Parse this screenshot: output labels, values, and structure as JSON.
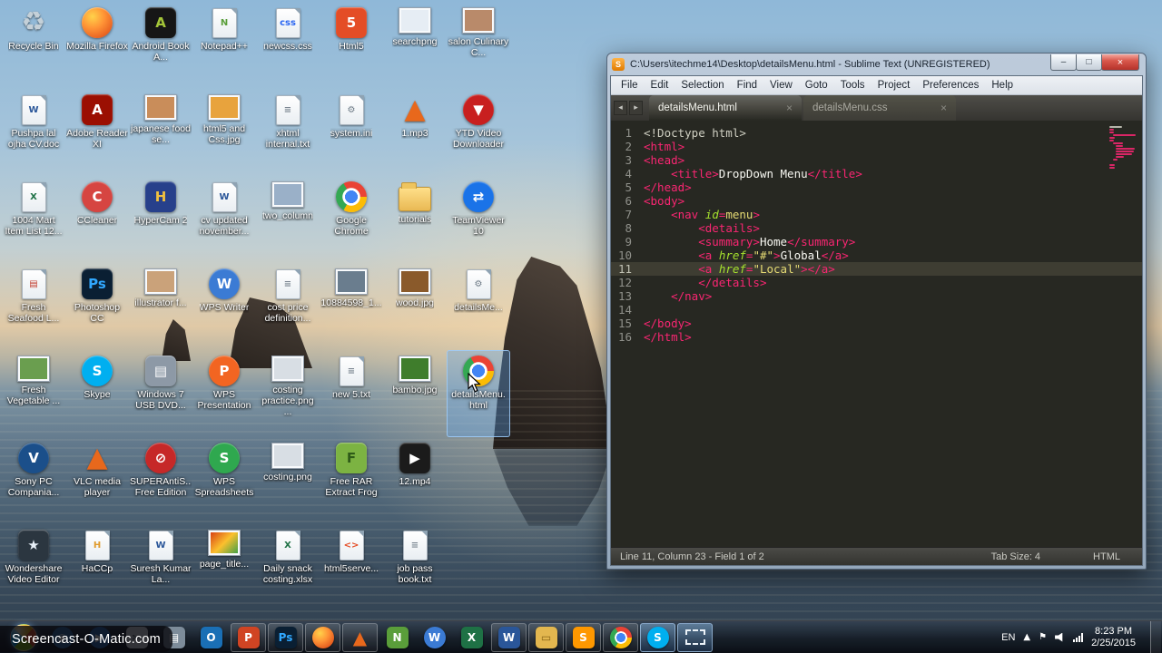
{
  "watermark": "Screencast-O-Matic.com",
  "window": {
    "title": "C:\\Users\\itechme14\\Desktop\\detailsMenu.html - Sublime Text (UNREGISTERED)",
    "app_icon_letter": "S",
    "controls": {
      "minimize": "–",
      "maximize": "□",
      "close": "×"
    },
    "menu": [
      "File",
      "Edit",
      "Selection",
      "Find",
      "View",
      "Goto",
      "Tools",
      "Project",
      "Preferences",
      "Help"
    ],
    "tab_arrows": {
      "left": "◂",
      "right": "▸"
    },
    "tabs": [
      {
        "label": "detailsMenu.html",
        "active": true
      },
      {
        "label": "detailsMenu.css",
        "active": false
      }
    ],
    "code": {
      "current_line": 11,
      "lines": [
        {
          "n": 1,
          "t": [
            [
              "plain",
              "<!Doctype html>"
            ]
          ]
        },
        {
          "n": 2,
          "t": [
            [
              "tag",
              "<html>"
            ]
          ]
        },
        {
          "n": 3,
          "t": [
            [
              "tag",
              "<head>"
            ]
          ]
        },
        {
          "n": 4,
          "t": [
            [
              "sp",
              "    "
            ],
            [
              "tag",
              "<title>"
            ],
            [
              "text",
              "DropDown Menu"
            ],
            [
              "tag",
              "</title>"
            ]
          ]
        },
        {
          "n": 5,
          "t": [
            [
              "tag",
              "</head>"
            ]
          ]
        },
        {
          "n": 6,
          "t": [
            [
              "tag",
              "<body>"
            ]
          ]
        },
        {
          "n": 7,
          "t": [
            [
              "sp",
              "    "
            ],
            [
              "tag",
              "<nav"
            ],
            [
              "sp",
              " "
            ],
            [
              "attr",
              "id"
            ],
            [
              "op",
              "="
            ],
            [
              "val",
              "menu"
            ],
            [
              "tag",
              ">"
            ]
          ]
        },
        {
          "n": 8,
          "t": [
            [
              "sp",
              "        "
            ],
            [
              "tag",
              "<details>"
            ]
          ]
        },
        {
          "n": 9,
          "t": [
            [
              "sp",
              "        "
            ],
            [
              "tag",
              "<summary>"
            ],
            [
              "text",
              "Home"
            ],
            [
              "tag",
              "</summary>"
            ]
          ]
        },
        {
          "n": 10,
          "t": [
            [
              "sp",
              "        "
            ],
            [
              "tag",
              "<a"
            ],
            [
              "sp",
              " "
            ],
            [
              "attr",
              "href"
            ],
            [
              "op",
              "="
            ],
            [
              "val",
              "\"#\""
            ],
            [
              "tag",
              ">"
            ],
            [
              "text",
              "Global"
            ],
            [
              "tag",
              "</a>"
            ]
          ]
        },
        {
          "n": 11,
          "t": [
            [
              "sp",
              "        "
            ],
            [
              "tag",
              "<a"
            ],
            [
              "sp",
              " "
            ],
            [
              "attr",
              "href"
            ],
            [
              "op",
              "="
            ],
            [
              "val",
              "\"Local\""
            ],
            [
              "tag",
              ">"
            ],
            [
              "tag",
              "</a>"
            ]
          ]
        },
        {
          "n": 12,
          "t": [
            [
              "sp",
              "        "
            ],
            [
              "tag",
              "</details>"
            ]
          ]
        },
        {
          "n": 13,
          "t": [
            [
              "sp",
              "    "
            ],
            [
              "tag",
              "</nav>"
            ]
          ]
        },
        {
          "n": 14,
          "t": []
        },
        {
          "n": 15,
          "t": [
            [
              "tag",
              "</body>"
            ]
          ]
        },
        {
          "n": 16,
          "t": [
            [
              "tag",
              "</html>"
            ]
          ]
        }
      ]
    },
    "status": {
      "left": "Line 11, Column 23 - Field 1 of 2",
      "tab_size": "Tab Size: 4",
      "syntax": "HTML"
    }
  },
  "desktop": {
    "icons": [
      {
        "name": "recycle-bin",
        "label": "Recycle Bin",
        "type": "sym",
        "glyph": "♻",
        "color": "#c4d0d8"
      },
      {
        "name": "firefox",
        "label": "Mozilla Firefox",
        "type": "app",
        "shape": "circle",
        "bg": "radial-gradient(circle at 35% 30%, #ffd24a 0%, #ff9436 40%, #e2551c 85%)",
        "glyph": ""
      },
      {
        "name": "android-book",
        "label": "Android Book A...",
        "type": "app",
        "bg": "#161616",
        "glyph": "A",
        "fg": "#a4c639"
      },
      {
        "name": "notepad-plus-plus",
        "label": "Notepad++",
        "type": "doc",
        "glyph": "N",
        "gcolor": "#5a9e3a"
      },
      {
        "name": "newcss-css",
        "label": "newcss.css",
        "type": "doc",
        "glyph": "css",
        "gcolor": "#2965f1"
      },
      {
        "name": "html5",
        "label": "Html5",
        "type": "app",
        "bg": "#e44d26",
        "glyph": "5"
      },
      {
        "name": "searchpng",
        "label": "searchpng",
        "type": "img",
        "bg": "#e6edf4"
      },
      {
        "name": "salon-culinary",
        "label": "salon Culinary C...",
        "type": "img",
        "bg": "#b98a6a"
      },
      {
        "name": "pushpa-cv-doc",
        "label": "Pushpa lal ojha CV.doc",
        "type": "doc",
        "glyph": "W",
        "gcolor": "#2a5699"
      },
      {
        "name": "adobe-reader",
        "label": "Adobe Reader XI",
        "type": "app",
        "bg": "#9b0f02",
        "glyph": "A"
      },
      {
        "name": "japanese-food",
        "label": "japanese food se...",
        "type": "img",
        "bg": "#c98d5a"
      },
      {
        "name": "html5-css-jpg",
        "label": "html5 and Css.jpg",
        "type": "img",
        "bg": "#e8a33d"
      },
      {
        "name": "xhtml-internal-txt",
        "label": "xhtml internal.txt",
        "type": "doc",
        "glyph": "≡",
        "gcolor": "#7a8590"
      },
      {
        "name": "system-ini",
        "label": "system.ini",
        "type": "doc",
        "glyph": "⚙",
        "gcolor": "#6d7a86"
      },
      {
        "name": "mp3-1",
        "label": "1.mp3",
        "type": "sym",
        "glyph": "▲",
        "color": "#e8681c"
      },
      {
        "name": "ytd-downloader",
        "label": "YTD Video Downloader",
        "type": "app",
        "shape": "circle",
        "bg": "#c81f1f",
        "glyph": "▼"
      },
      {
        "name": "mart-item-list",
        "label": "1004 Mart Item List 12...",
        "type": "doc",
        "glyph": "X",
        "gcolor": "#1e7145"
      },
      {
        "name": "ccleaner",
        "label": "CCleaner",
        "type": "app",
        "shape": "circle",
        "bg": "#d64541",
        "glyph": "C"
      },
      {
        "name": "hypercam",
        "label": "HyperCam 2",
        "type": "app",
        "bg": "#27408b",
        "glyph": "H",
        "fg": "#f0c040"
      },
      {
        "name": "cv-updated",
        "label": "cv updated november...",
        "type": "doc",
        "glyph": "W",
        "gcolor": "#2a5699"
      },
      {
        "name": "two-column",
        "label": "two_column",
        "type": "img",
        "bg": "#9ab0c8"
      },
      {
        "name": "google-chrome",
        "label": "Google Chrome",
        "type": "chrome"
      },
      {
        "name": "tutorials-folder",
        "label": "tutorials",
        "type": "folder"
      },
      {
        "name": "teamviewer",
        "label": "TeamViewer 10",
        "type": "app",
        "shape": "circle",
        "bg": "#1a73e8",
        "glyph": "⇄"
      },
      {
        "name": "fresh-seafood",
        "label": "Fresh Seafood L...",
        "type": "doc",
        "glyph": "▤",
        "gcolor": "#c0392b"
      },
      {
        "name": "photoshop",
        "label": "Photoshop CC",
        "type": "app",
        "bg": "#0a1f33",
        "glyph": "Ps",
        "fg": "#31a8ff"
      },
      {
        "name": "illustrator-file",
        "label": "illustrator f...",
        "type": "img",
        "bg": "#caa27a"
      },
      {
        "name": "wps-writer",
        "label": "WPS Writer",
        "type": "app",
        "shape": "circle",
        "bg": "#3b7bd4",
        "glyph": "W"
      },
      {
        "name": "cost-price",
        "label": "cost price definition...",
        "type": "doc",
        "glyph": "≡",
        "gcolor": "#7a8590"
      },
      {
        "name": "img-10884598",
        "label": "10884598_1...",
        "type": "img",
        "bg": "#6a7d8e"
      },
      {
        "name": "wood-jpg",
        "label": "wood.jpg",
        "type": "img",
        "bg": "#8a5a2b"
      },
      {
        "name": "detailsmenu-css",
        "label": "detailsMe...",
        "type": "doc",
        "glyph": "⚙",
        "gcolor": "#6d7a86"
      },
      {
        "name": "fresh-vegetable",
        "label": "Fresh Vegetable ...",
        "type": "img",
        "bg": "#6a9e4f"
      },
      {
        "name": "skype",
        "label": "Skype",
        "type": "app",
        "shape": "circle",
        "bg": "#00aff0",
        "glyph": "S"
      },
      {
        "name": "windows-usb-dvd",
        "label": "Windows 7 USB DVD...",
        "type": "app",
        "bg": "#8d99a6",
        "glyph": "▤"
      },
      {
        "name": "wps-presentation",
        "label": "WPS Presentation",
        "type": "app",
        "shape": "circle",
        "bg": "#f26522",
        "glyph": "P"
      },
      {
        "name": "costing-practice",
        "label": "costing practice.png ...",
        "type": "img",
        "bg": "#d8dee4"
      },
      {
        "name": "new5-txt",
        "label": "new 5.txt",
        "type": "doc",
        "glyph": "≡",
        "gcolor": "#7a8590"
      },
      {
        "name": "bambo-jpg",
        "label": "bambo.jpg",
        "type": "img",
        "bg": "#3f7d2c"
      },
      {
        "name": "detailsmenu-html",
        "label": "detailsMenu. html",
        "type": "chrome",
        "selected": true
      },
      {
        "name": "sony-pc-companion",
        "label": "Sony PC Compania...",
        "type": "app",
        "shape": "circle",
        "bg": "#1b4f8a",
        "glyph": "V"
      },
      {
        "name": "vlc",
        "label": "VLC media player",
        "type": "sym",
        "glyph": "▲",
        "color": "#e8681c"
      },
      {
        "name": "superantispyware",
        "label": "SUPERAntiS... Free Edition",
        "type": "app",
        "shape": "circle",
        "bg": "#c62828",
        "glyph": "⊘"
      },
      {
        "name": "wps-spreadsheets",
        "label": "WPS Spreadsheets",
        "type": "app",
        "shape": "circle",
        "bg": "#2fa84f",
        "glyph": "S"
      },
      {
        "name": "costing-png",
        "label": "costing.png",
        "type": "img",
        "bg": "#d8dee4"
      },
      {
        "name": "rar-extract-frog",
        "label": "Free RAR Extract Frog",
        "type": "app",
        "bg": "#7cb342",
        "glyph": "F",
        "fg": "#2e5b18"
      },
      {
        "name": "mp4-12",
        "label": "12.mp4",
        "type": "app",
        "bg": "#1b1b1b",
        "glyph": "▶"
      },
      {
        "type": "empty"
      },
      {
        "name": "wondershare-video-editor",
        "label": "Wondershare Video Editor",
        "type": "app",
        "bg": "#2b3640",
        "glyph": "★",
        "fg": "#e8f0f8"
      },
      {
        "name": "haccp",
        "label": "HaCCp",
        "type": "doc",
        "glyph": "H",
        "gcolor": "#e09b2d"
      },
      {
        "name": "suresh-kumar",
        "label": "Suresh Kumar La...",
        "type": "doc",
        "glyph": "W",
        "gcolor": "#2a5699"
      },
      {
        "name": "page-title",
        "label": "page_title...",
        "type": "img",
        "bg": "linear-gradient(135deg,#d84315 0%,#fbc02d 50%,#43a047 100%)"
      },
      {
        "name": "daily-snack-xlsx",
        "label": "Daily snack costing.xlsx",
        "type": "doc",
        "glyph": "X",
        "gcolor": "#1e7145"
      },
      {
        "name": "html5serve",
        "label": "html5serve...",
        "type": "doc",
        "glyph": "<>",
        "gcolor": "#e44d26"
      },
      {
        "name": "job-pass-book",
        "label": "job pass book.txt",
        "type": "doc",
        "glyph": "≡",
        "gcolor": "#7a8590"
      },
      {
        "type": "empty"
      }
    ]
  },
  "taskbar": {
    "items": [
      {
        "name": "screencast-o-matic",
        "glyph": "◉",
        "bg": "#2f6fb2",
        "shape": "circle"
      },
      {
        "name": "windows-media-player",
        "glyph": "▶",
        "bg": "#2a6fc0",
        "shape": "circle"
      },
      {
        "name": "snipping-tool",
        "glyph": "✂",
        "bg": "#eef2f6",
        "fg": "#33404d"
      },
      {
        "name": "wordpad",
        "glyph": "▤",
        "bg": "#7d8c9a"
      },
      {
        "name": "outlook",
        "glyph": "O",
        "bg": "#1a6fb5"
      },
      {
        "name": "powerpoint",
        "glyph": "P",
        "bg": "#d04423",
        "running": true
      },
      {
        "name": "photoshop",
        "glyph": "Ps",
        "bg": "#0a1f33",
        "fg": "#31a8ff",
        "running": true
      },
      {
        "name": "firefox",
        "glyph": "",
        "bg": "radial-gradient(circle at 35% 30%, #ffd24a, #ff9436 40%, #e2551c 80%)",
        "shape": "circle",
        "running": true
      },
      {
        "name": "vlc",
        "glyph": "▲",
        "fg": "#e8681c",
        "sym": true,
        "running": true
      },
      {
        "name": "notepad-plus-plus",
        "glyph": "N",
        "bg": "#5a9e3a"
      },
      {
        "name": "wps-writer",
        "glyph": "W",
        "bg": "#3b7bd4",
        "shape": "circle"
      },
      {
        "name": "excel",
        "glyph": "X",
        "bg": "#1e7145"
      },
      {
        "name": "word",
        "glyph": "W",
        "bg": "#2a5699",
        "running": true
      },
      {
        "name": "explorer",
        "glyph": "▭",
        "bg": "#e3b74f",
        "fg": "#8a6516",
        "running": true
      },
      {
        "name": "sublime-text",
        "glyph": "S",
        "bg": "#ff9800",
        "running": true
      },
      {
        "name": "chrome",
        "type": "chrome",
        "running": true
      },
      {
        "name": "skype",
        "glyph": "S",
        "bg": "#00aff0",
        "shape": "circle",
        "running": true,
        "active": true
      },
      {
        "name": "screen-recorder",
        "dashed": true,
        "running": true,
        "active": true
      }
    ],
    "tray": {
      "lang": "EN",
      "show_hidden": "▲",
      "flag": "⚑",
      "time": "8:23 PM",
      "date": "2/25/2015"
    }
  }
}
